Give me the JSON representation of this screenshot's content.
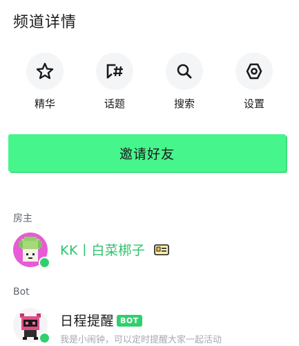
{
  "page": {
    "title": "频道详情"
  },
  "actions": [
    {
      "label": "精华",
      "icon": "star-icon"
    },
    {
      "label": "话题",
      "icon": "topic-hash-icon"
    },
    {
      "label": "搜索",
      "icon": "search-icon"
    },
    {
      "label": "设置",
      "icon": "settings-icon"
    }
  ],
  "invite_button": {
    "label": "邀请好友"
  },
  "sections": {
    "owner": {
      "label": "房主"
    },
    "bot": {
      "label": "Bot"
    }
  },
  "owner": {
    "name": "KK丨白菜梆子",
    "online": true
  },
  "bot_member": {
    "name": "日程提醒",
    "badge": "BOT",
    "description": "我是小闹钟，可以定时提醒大家一起活动",
    "online": true
  },
  "colors": {
    "accent": "#46f58b",
    "online": "#2fd06c",
    "owner_name": "#2cc36a"
  }
}
